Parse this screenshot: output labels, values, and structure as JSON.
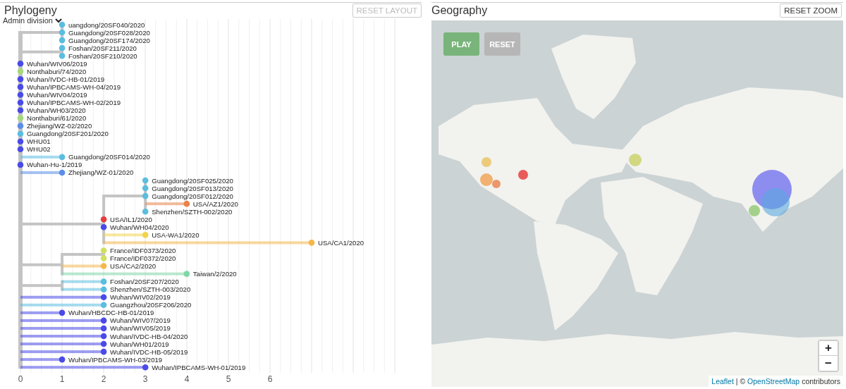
{
  "phylogeny": {
    "title": "Phylogeny",
    "reset_button": {
      "label": "RESET LAYOUT",
      "disabled": true
    },
    "color_by": "Admin division",
    "axis_ticks": [
      "0",
      "1",
      "2",
      "3",
      "4",
      "5",
      "6"
    ],
    "tree": {
      "children": [
        {
          "level": 0.143,
          "children": [
            {
              "name": "uangdong/20SF040/2020",
              "level": 0.143,
              "color": "#5bbde0"
            },
            {
              "name": "Guangdong/20SF028/2020",
              "level": 0.143,
              "color": "#5bbde0"
            },
            {
              "name": "Guangdong/20SF174/2020",
              "level": 0.143,
              "color": "#5bbde0"
            }
          ]
        },
        {
          "level": 0.143,
          "children": [
            {
              "name": "Foshan/20SF211/2020",
              "level": 0.143,
              "color": "#5bbde0"
            },
            {
              "name": "Foshan/20SF210/2020",
              "level": 0.143,
              "color": "#5bbde0"
            }
          ]
        },
        {
          "name": "Wuhan/WIV06/2019",
          "level": 0,
          "color": "#4a4ae8"
        },
        {
          "name": "Nonthaburi/74/2020",
          "level": 0,
          "color": "#a6d97c"
        },
        {
          "name": "Wuhan/IVDC-HB-01/2019",
          "level": 0,
          "color": "#4a4ae8"
        },
        {
          "name": "Wuhan/IPBCAMS-WH-04/2019",
          "level": 0,
          "color": "#4a4ae8"
        },
        {
          "name": "Wuhan/WIV04/2019",
          "level": 0,
          "color": "#4a4ae8"
        },
        {
          "name": "Wuhan/IPBCAMS-WH-02/2019",
          "level": 0,
          "color": "#4a4ae8"
        },
        {
          "name": "Wuhan/WH03/2020",
          "level": 0,
          "color": "#4a4ae8"
        },
        {
          "name": "Nonthaburi/61/2020",
          "level": 0,
          "color": "#a6d97c"
        },
        {
          "name": "Zhejiang/WZ-02/2020",
          "level": 0,
          "color": "#5a8ee8"
        },
        {
          "name": "Guangdong/20SF201/2020",
          "level": 0,
          "color": "#5bbde0"
        },
        {
          "name": "WHU01",
          "level": 0,
          "color": "#4a4ae8"
        },
        {
          "name": "WHU02",
          "level": 0,
          "color": "#4a4ae8"
        },
        {
          "name": "Guangdong/20SF014/2020",
          "level": 0.143,
          "color": "#5bbde0"
        },
        {
          "name": "Wuhan-Hu-1/2019",
          "level": 0,
          "color": "#4a4ae8"
        },
        {
          "name": "Zhejiang/WZ-01/2020",
          "level": 0.143,
          "color": "#5a8ee8"
        },
        {
          "level": 0.286,
          "children": [
            {
              "level": 0.429,
              "children": [
                {
                  "name": "Guangdong/20SF025/2020",
                  "level": 0.429,
                  "color": "#5bbde0"
                },
                {
                  "name": "Guangdong/20SF013/2020",
                  "level": 0.429,
                  "color": "#5bbde0"
                },
                {
                  "name": "Guangdong/20SF012/2020",
                  "level": 0.429,
                  "color": "#5bbde0"
                },
                {
                  "name": "USA/AZ1/2020",
                  "level": 0.571,
                  "color": "#e8834a"
                },
                {
                  "name": "Shenzhen/SZTH-002/2020",
                  "level": 0.429,
                  "color": "#5bbde0"
                }
              ]
            },
            {
              "name": "USA/IL1/2020",
              "level": 0.286,
              "color": "#e83c3c"
            },
            {
              "name": "Wuhan/WH04/2020",
              "level": 0.286,
              "color": "#4a4ae8"
            },
            {
              "name": "USA-WA1/2020",
              "level": 0.429,
              "color": "#f0d44c"
            },
            {
              "name": "USA/CA1/2020",
              "level": 1,
              "color": "#f4b74a"
            }
          ]
        },
        {
          "level": 0.143,
          "children": [
            {
              "level": 0.286,
              "children": [
                {
                  "name": "France/IDF0373/2020",
                  "level": 0.286,
                  "color": "#cfe05c"
                },
                {
                  "name": "France/IDF0372/2020",
                  "level": 0.286,
                  "color": "#cfe05c"
                }
              ]
            },
            {
              "name": "USA/CA2/2020",
              "level": 0.286,
              "color": "#f4b74a"
            },
            {
              "name": "Taiwan/2/2020",
              "level": 0.571,
              "color": "#80d6a6"
            }
          ]
        },
        {
          "level": 0.143,
          "children": [
            {
              "name": "Foshan/20SF207/2020",
              "level": 0.286,
              "color": "#5bbde0"
            },
            {
              "name": "Shenzhen/SZTH-003/2020",
              "level": 0.286,
              "color": "#5bbde0"
            }
          ]
        },
        {
          "name": "Wuhan/WIV02/2019",
          "level": 0.286,
          "color": "#4a4ae8"
        },
        {
          "name": "Guangzhou/20SF206/2020",
          "level": 0.286,
          "color": "#5bbde0"
        },
        {
          "name": "Wuhan/HBCDC-HB-01/2019",
          "level": 0.143,
          "color": "#4a4ae8"
        },
        {
          "name": "Wuhan/WIV07/2019",
          "level": 0.286,
          "color": "#4a4ae8"
        },
        {
          "name": "Wuhan/WIV05/2019",
          "level": 0.286,
          "color": "#4a4ae8"
        },
        {
          "name": "Wuhan/IVDC-HB-04/2020",
          "level": 0.286,
          "color": "#4a4ae8"
        },
        {
          "name": "Wuhan/WH01/2019",
          "level": 0.286,
          "color": "#4a4ae8"
        },
        {
          "name": "Wuhan/IVDC-HB-05/2019",
          "level": 0.286,
          "color": "#4a4ae8"
        },
        {
          "name": "Wuhan/IPBCAMS-WH-03/2019",
          "level": 0.143,
          "color": "#4a4ae8"
        },
        {
          "name": "Wuhan/IPBCAMS-WH-01/2019",
          "level": 0.429,
          "color": "#4a4ae8"
        }
      ]
    }
  },
  "geography": {
    "title": "Geography",
    "reset_button": {
      "label": "RESET ZOOM",
      "disabled": false
    },
    "animation_buttons": [
      {
        "label": "PLAY",
        "kind": "play"
      },
      {
        "label": "RESET",
        "kind": "reset"
      }
    ],
    "zoom_buttons": [
      {
        "label": "+",
        "kind": "in"
      },
      {
        "label": "−",
        "kind": "out"
      }
    ],
    "attribution": [
      {
        "text": "Leaflet",
        "kind": "link"
      },
      {
        "text": "| ©",
        "kind": "text"
      },
      {
        "text": "OpenStreetMap",
        "kind": "link"
      },
      {
        "text": "contributors",
        "kind": "text"
      }
    ]
  }
}
